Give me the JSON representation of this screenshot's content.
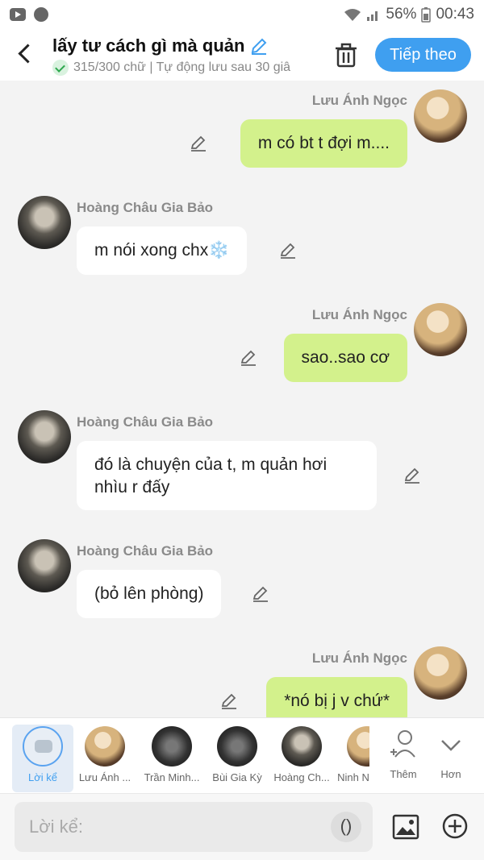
{
  "status_bar": {
    "battery": "56%",
    "time": "00:43"
  },
  "header": {
    "title": "lấy tư cách gì mà quản",
    "subtitle": "315/300 chữ | Tự động lưu sau 30 giâ",
    "next_button": "Tiếp theo"
  },
  "messages": [
    {
      "sender": "Lưu Ánh Ngọc",
      "side": "right",
      "text": "m có bt t đợi m...."
    },
    {
      "sender": "Hoàng Châu Gia Bảo",
      "side": "left",
      "text": "m nói xong chx❄️"
    },
    {
      "sender": "Lưu Ánh Ngọc",
      "side": "right",
      "text": "sao..sao cơ"
    },
    {
      "sender": "Hoàng Châu Gia Bảo",
      "side": "left",
      "text": "đó là chuyện của t, m quản hơi nhìu r đấy"
    },
    {
      "sender": "Hoàng Châu Gia Bảo",
      "side": "left",
      "text": "(bỏ lên phòng)"
    },
    {
      "sender": "Lưu Ánh Ngọc",
      "side": "right",
      "text": "*nó bị j v chứ*"
    }
  ],
  "characters": [
    {
      "label": "Lời kể",
      "selected": true
    },
    {
      "label": "Lưu Ánh ..."
    },
    {
      "label": "Trần Minh..."
    },
    {
      "label": "Bùi Gia Kỳ"
    },
    {
      "label": "Hoàng Ch..."
    },
    {
      "label": "Ninh N"
    }
  ],
  "char_actions": {
    "more": "Thêm",
    "less": "Hơn"
  },
  "input": {
    "placeholder": "Lời kể:",
    "paren": "()"
  },
  "colors": {
    "accent": "#3f9ff0",
    "my_bubble": "#d3f18c",
    "their_bubble": "#ffffff"
  }
}
